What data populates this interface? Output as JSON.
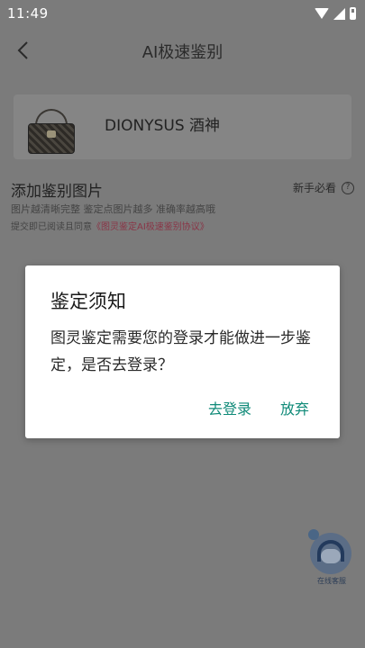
{
  "status_bar": {
    "time": "11:49"
  },
  "header": {
    "title": "AI极速鉴别"
  },
  "product": {
    "name": "DIONYSUS 酒神"
  },
  "upload": {
    "title": "添加鉴别图片",
    "guide_label": "新手必看",
    "hint": "图片越清晰完整 鉴定点图片越多 准确率越高哦",
    "agreement_prefix": "提交即已阅读且同意",
    "agreement_link": "《图灵鉴定AI极速鉴别协议》"
  },
  "dialog": {
    "title": "鉴定须知",
    "message": "图灵鉴定需要您的登录才能做进一步鉴定，是否去登录？",
    "confirm_label": "去登录",
    "cancel_label": "放弃"
  },
  "service": {
    "label": "在线客服"
  },
  "colors": {
    "accent": "#0f8a78",
    "link": "#8a3446",
    "overlay": "#7b7b7b"
  }
}
